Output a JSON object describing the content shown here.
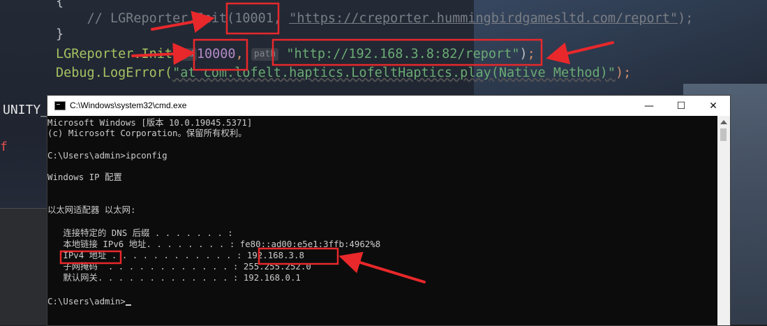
{
  "code": {
    "line1_brace": "{",
    "comment_prefix": "// ",
    "comment_call": "LGReporter.Init(",
    "comment_num": "10001",
    "comment_sep": ", ",
    "comment_url": "\"https://creporter.hummingbirdgamesltd.com/report\"",
    "comment_tail": ");",
    "line3_brace": "}",
    "call_name": "LGReporter.Init(",
    "hint_id": "id",
    "num_value": "10000",
    "sep": ",",
    "hint_path": "path",
    "url_value": "\"http://192.168.3.8:82/report\"",
    "close_paren": ")",
    "semicolon": ";",
    "debug_call": "Debug.LogError(",
    "debug_msg": "\"at com.lofelt.haptics.LofeltHaptics.play(Native Method)\"",
    "debug_tail": ");",
    "left_label": "UNITY_",
    "left_red": "f"
  },
  "cmd": {
    "title": "C:\\Windows\\system32\\cmd.exe",
    "minimize": "—",
    "maximize": "☐",
    "close": "✕",
    "lines": [
      "Microsoft Windows [版本 10.0.19045.5371]",
      "(c) Microsoft Corporation。保留所有权利。",
      "",
      "C:\\Users\\admin>ipconfig",
      "",
      "Windows IP 配置",
      "",
      "",
      "以太网适配器 以太网:",
      "",
      "   连接特定的 DNS 后缀 . . . . . . . :",
      "   本地链接 IPv6 地址. . . . . . . . : fe80::ad00:e5e1:3ffb:4962%8",
      "   IPv4 地址 . . . . . . . . . . . . : 192.168.3.8",
      "   子网掩码  . . . . . . . . . . . . : 255.255.252.0",
      "   默认网关. . . . . . . . . . . . . : 192.168.0.1",
      "",
      "C:\\Users\\admin>"
    ]
  },
  "colors": {
    "annotation_red": "#e8282b"
  }
}
